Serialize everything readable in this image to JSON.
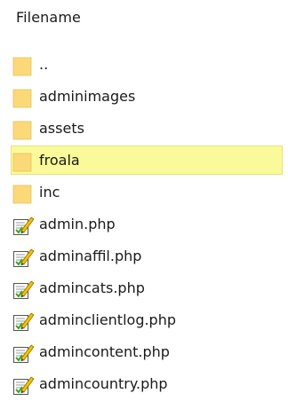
{
  "header": {
    "title": "Filename"
  },
  "files": [
    {
      "name": "..",
      "type": "folder",
      "icon": "folder-icon",
      "selected": false
    },
    {
      "name": "adminimages",
      "type": "folder",
      "icon": "folder-icon",
      "selected": false
    },
    {
      "name": "assets",
      "type": "folder",
      "icon": "folder-icon",
      "selected": false
    },
    {
      "name": "froala",
      "type": "folder",
      "icon": "folder-icon",
      "selected": true
    },
    {
      "name": "inc",
      "type": "folder",
      "icon": "folder-icon",
      "selected": false
    },
    {
      "name": "admin.php",
      "type": "file",
      "icon": "edit-file-icon",
      "selected": false
    },
    {
      "name": "adminaffil.php",
      "type": "file",
      "icon": "edit-file-icon",
      "selected": false
    },
    {
      "name": "admincats.php",
      "type": "file",
      "icon": "edit-file-icon",
      "selected": false
    },
    {
      "name": "adminclientlog.php",
      "type": "file",
      "icon": "edit-file-icon",
      "selected": false
    },
    {
      "name": "admincontent.php",
      "type": "file",
      "icon": "edit-file-icon",
      "selected": false
    },
    {
      "name": "admincountry.php",
      "type": "file",
      "icon": "edit-file-icon",
      "selected": false
    }
  ],
  "colors": {
    "selection_bg": "#fbfa9a",
    "folder": "#fbd978",
    "pencil": "#f2c200",
    "check": "#3aa51d"
  }
}
